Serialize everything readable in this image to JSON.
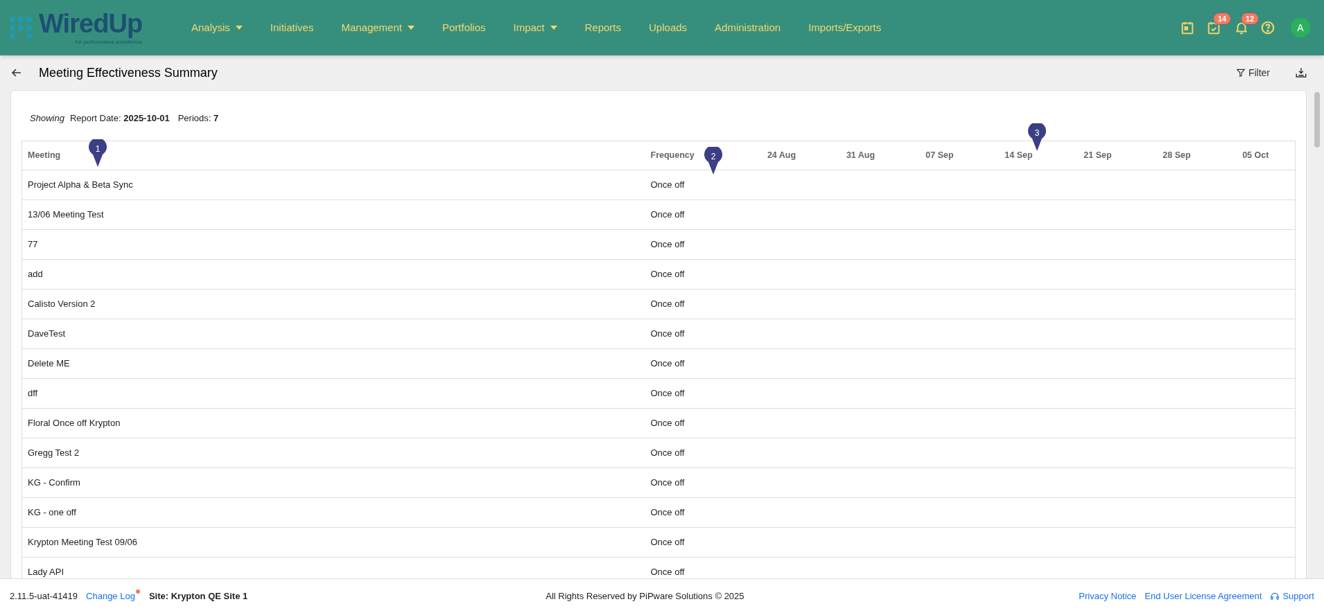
{
  "header": {
    "logo": {
      "name": "WiredUp",
      "tagline": "for performance excellence"
    },
    "nav": [
      {
        "label": "Analysis",
        "dropdown": true
      },
      {
        "label": "Initiatives",
        "dropdown": false
      },
      {
        "label": "Management",
        "dropdown": true
      },
      {
        "label": "Portfolios",
        "dropdown": false
      },
      {
        "label": "Impact",
        "dropdown": true
      },
      {
        "label": "Reports",
        "dropdown": false
      },
      {
        "label": "Uploads",
        "dropdown": false
      },
      {
        "label": "Administration",
        "dropdown": false
      },
      {
        "label": "Imports/Exports",
        "dropdown": false
      }
    ],
    "tasks_badge": "14",
    "notifications_badge": "12",
    "avatar": "A"
  },
  "page": {
    "title": "Meeting Effectiveness Summary",
    "filter": "Filter"
  },
  "summary": {
    "showing": "Showing",
    "report_date_label": "Report Date:",
    "report_date": "2025-10-01",
    "periods_label": "Periods:",
    "periods": "7"
  },
  "table": {
    "columns": [
      "Meeting",
      "Frequency",
      "24 Aug",
      "31 Aug",
      "07 Sep",
      "14 Sep",
      "21 Sep",
      "28 Sep",
      "05 Oct"
    ],
    "rows": [
      {
        "meeting": "Project Alpha & Beta Sync",
        "frequency": "Once off"
      },
      {
        "meeting": "13/06 Meeting Test",
        "frequency": "Once off"
      },
      {
        "meeting": "77",
        "frequency": "Once off"
      },
      {
        "meeting": "add",
        "frequency": "Once off"
      },
      {
        "meeting": "Calisto Version 2",
        "frequency": "Once off"
      },
      {
        "meeting": "DaveTest",
        "frequency": "Once off"
      },
      {
        "meeting": "Delete ME",
        "frequency": "Once off"
      },
      {
        "meeting": "dff",
        "frequency": "Once off"
      },
      {
        "meeting": "Floral Once off Krypton",
        "frequency": "Once off"
      },
      {
        "meeting": "Gregg Test 2",
        "frequency": "Once off"
      },
      {
        "meeting": "KG - Confirm",
        "frequency": "Once off"
      },
      {
        "meeting": "KG - one off",
        "frequency": "Once off"
      },
      {
        "meeting": "Krypton Meeting Test 09/06",
        "frequency": "Once off"
      },
      {
        "meeting": "Lady API",
        "frequency": "Once off"
      }
    ]
  },
  "markers": [
    {
      "label": "1"
    },
    {
      "label": "2"
    },
    {
      "label": "3"
    }
  ],
  "footer": {
    "version": "2.11.5-uat-41419",
    "change_log": "Change Log",
    "change_log_dot": true,
    "site": "Site: Krypton QE Site 1",
    "copyright": "All Rights Reserved by PiPware Solutions © 2025",
    "links": [
      "Privacy Notice",
      "End User License Agreement"
    ],
    "support": "Support"
  }
}
